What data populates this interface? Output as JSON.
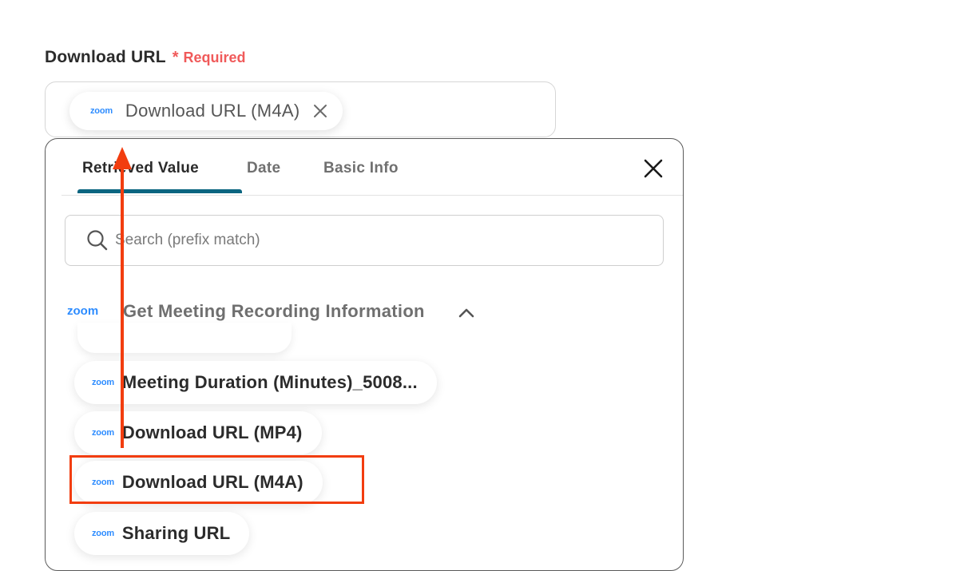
{
  "field": {
    "label": "Download URL",
    "required_mark": "*",
    "required_text": "Required"
  },
  "selected_chip": {
    "logo_text": "zoom",
    "label": "Download URL (M4A)",
    "remove_icon": "close-icon"
  },
  "popup": {
    "tabs": [
      {
        "label": "Retrieved Value",
        "active": true
      },
      {
        "label": "Date",
        "active": false
      },
      {
        "label": "Basic Info",
        "active": false
      }
    ],
    "close_icon": "close-icon",
    "search": {
      "placeholder": "Search (prefix match)",
      "value": "",
      "icon": "search-icon"
    },
    "group": {
      "logo_text": "zoom",
      "title": "Get Meeting Recording Information",
      "toggle_icon": "chevron-up-icon"
    },
    "items": [
      {
        "logo_text": "zoom",
        "label": "Meeting Duration (Minutes)_5008..."
      },
      {
        "logo_text": "zoom",
        "label": "Download URL (MP4)"
      },
      {
        "logo_text": "zoom",
        "label": "Download URL (M4A)"
      },
      {
        "logo_text": "zoom",
        "label": "Sharing URL"
      }
    ]
  },
  "colors": {
    "required": "#f05a5a",
    "tab_underline": "#0b6580",
    "zoom_brand": "#2d8cff",
    "annotation": "#f23d0f"
  }
}
